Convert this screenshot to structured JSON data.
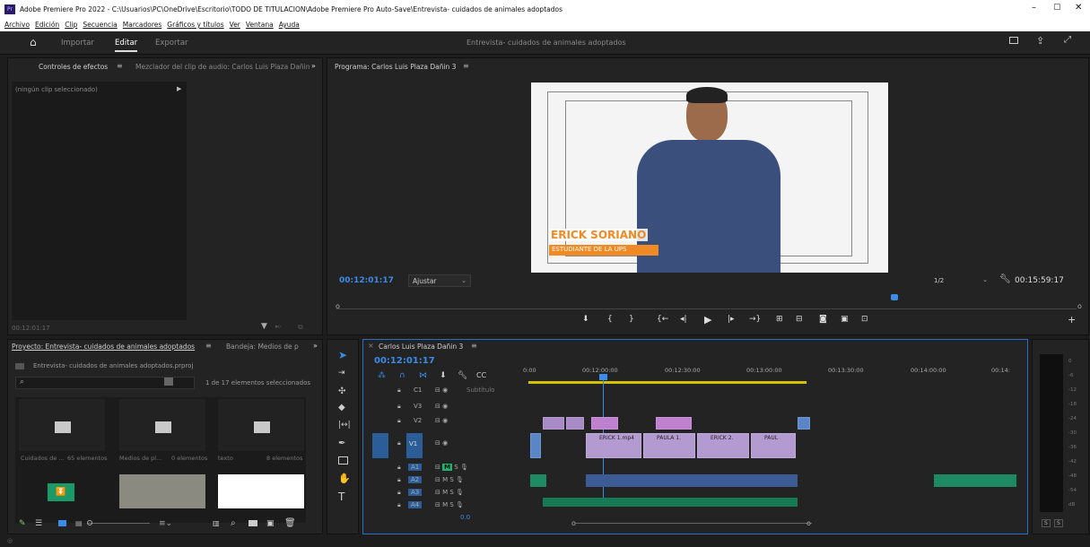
{
  "window": {
    "title": "Adobe Premiere Pro 2022 - C:\\Usuarios\\PC\\OneDrive\\Escritorio\\TODO DE TITULACION\\Adobe Premiere Pro Auto-Save\\Entrevista- cuidados de animales adoptados",
    "icon_label": "Pr"
  },
  "menu": [
    "Archivo",
    "Edición",
    "Clip",
    "Secuencia",
    "Marcadores",
    "Gráficos y títulos",
    "Ver",
    "Ventana",
    "Ayuda"
  ],
  "topbar": {
    "tabs": [
      "Importar",
      "Editar",
      "Exportar"
    ],
    "active": "Editar",
    "project_title": "Entrevista- cuidados de animales adoptados"
  },
  "effects": {
    "tab1": "Controles de efectos",
    "tab2": "Mezclador del clip de audio: Carlos Luis Plaza Dañin",
    "empty": "(ningún clip seleccionado)",
    "time": "00:12:01:17"
  },
  "program": {
    "title": "Programa: Carlos Luis Plaza Dañin 3",
    "timecode": "00:12:01:17",
    "fit": "Ajustar",
    "quality": "1/2",
    "duration": "00:15:59:17",
    "lower_third_name": "ERICK SORIANO",
    "lower_third_sub": "ESTUDIANTE DE LA UPS"
  },
  "project": {
    "tab1": "Proyecto: Entrevista- cuidados de animales adoptados",
    "tab2": "Bandeja: Medios de p",
    "file": "Entrevista- cuidados de animales adoptados.prproj",
    "selection": "1 de 17 elementos seleccionados",
    "bins": [
      {
        "name": "Cuidados de ...",
        "count": "65 elementos"
      },
      {
        "name": "Medios de pl...",
        "count": "0 elementos"
      },
      {
        "name": "texto",
        "count": "8 elementos"
      }
    ]
  },
  "timeline": {
    "tab": "Carlos Luis Plaza Dañin 3",
    "timecode": "00:12:01:17",
    "ruler": [
      "0:00",
      "00:12:00:00",
      "00:12:30:00",
      "00:13:00:00",
      "00:13:30:00",
      "00:14:00:00",
      "00:14:"
    ],
    "tracks_video": [
      "C1",
      "V3",
      "V2",
      "V1"
    ],
    "tracks_audio": [
      "A1",
      "A2",
      "A3",
      "A4"
    ],
    "subtitle": "Subtítulo",
    "volume": "0.0",
    "clip_labels": [
      "ERICK 1.mp4",
      "PAULA 1.",
      "ERICK 2.",
      "PAUL"
    ]
  },
  "meter": {
    "scale": [
      "0",
      "-6",
      "-12",
      "-18",
      "-24",
      "-30",
      "-36",
      "-42",
      "-48",
      "-54",
      "dB"
    ],
    "solo": [
      "S",
      "S"
    ]
  }
}
